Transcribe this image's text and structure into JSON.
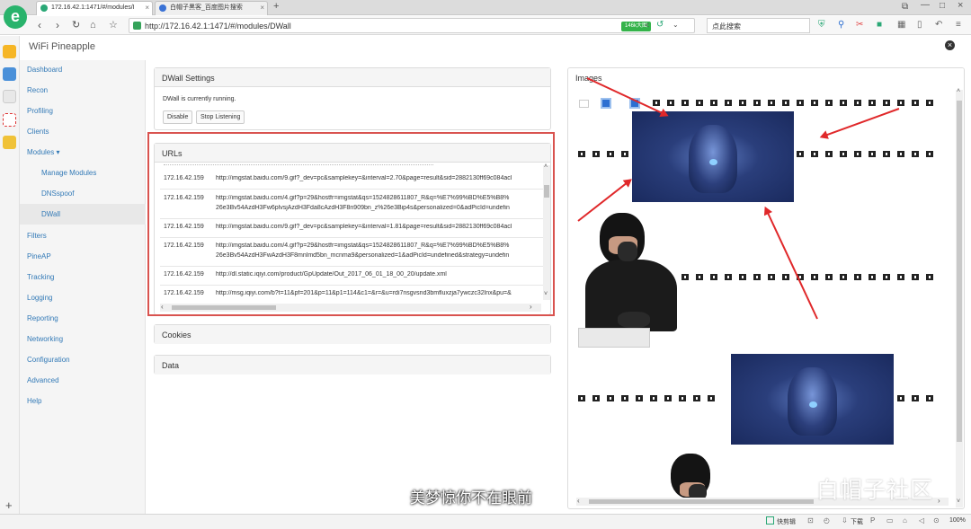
{
  "browser": {
    "tabs": [
      {
        "title": "172.16.42.1:1471/#/modules/I",
        "active": true
      },
      {
        "title": "白帽子黑客_百度图片搜索",
        "active": false
      }
    ],
    "new_tab": "+",
    "url": "http://172.16.42.1:1471/#/modules/DWall",
    "badge": "146k大图",
    "search_placeholder": "点此搜索"
  },
  "app": {
    "title": "WiFi Pineapple",
    "close": "×"
  },
  "sidebar": {
    "items": [
      {
        "label": "Dashboard"
      },
      {
        "label": "Recon"
      },
      {
        "label": "Profiling"
      },
      {
        "label": "Clients"
      },
      {
        "label": "Modules ▾"
      },
      {
        "label": "Filters"
      },
      {
        "label": "PineAP"
      },
      {
        "label": "Tracking"
      },
      {
        "label": "Logging"
      },
      {
        "label": "Reporting"
      },
      {
        "label": "Networking"
      },
      {
        "label": "Configuration"
      },
      {
        "label": "Advanced"
      },
      {
        "label": "Help"
      }
    ],
    "subitems": [
      {
        "label": "Manage Modules"
      },
      {
        "label": "DNSspoof"
      },
      {
        "label": "DWall"
      }
    ],
    "add": "+"
  },
  "dwall": {
    "title": "DWall Settings",
    "status": "DWall is currently running.",
    "disable_label": "Disable",
    "stop_label": "Stop Listening"
  },
  "urls": {
    "title": "URLs",
    "rows": [
      {
        "ip": "172.16.42.159",
        "url": "http://imgstat.baidu.com/9.gif?_dev=pc&samplekey=&interval=2.70&page=result&sid=2882130ff69c084acl",
        "url2": ""
      },
      {
        "ip": "172.16.42.159",
        "url": "http://imgstat.baidu.com/4.gif?p=29&hostfr=imgstat&qs=1524828611807_R&q=%E7%99%BD%E5%B8%",
        "url2": "26e3Bv54AzdH3Fw6plvsjAzdH3Fda8cAzdH3F8n909bn_z%26e3Bip4s&personalized=0&adPicId=undefin"
      },
      {
        "ip": "172.16.42.159",
        "url": "http://imgstat.baidu.com/9.gif?_dev=pc&samplekey=&interval=1.81&page=result&sid=2882130ff69c084acl",
        "url2": ""
      },
      {
        "ip": "172.16.42.159",
        "url": "http://imgstat.baidu.com/4.gif?p=29&hostfr=imgstat&qs=1524828611807_R&q=%E7%99%BD%E5%B8%",
        "url2": "26e3Bv54AzdH3FwAzdH3F8mnlmd5bn_mcnma9&personalized=1&adPicId=undefined&strategy=undefin"
      },
      {
        "ip": "172.16.42.159",
        "url": "http://dl.static.iqiyi.com/product/GpUpdate/Out_2017_06_01_18_00_20/update.xml",
        "url2": ""
      },
      {
        "ip": "172.16.42.159",
        "url": "http://msg.iqiyi.com/b?t=11&pf=201&p=11&p1=114&c1=&r=&u=rdi7nsgvsnd3bmfluxzja7ywczc32lnx&pu=&",
        "url2": ""
      }
    ]
  },
  "cookies": {
    "title": "Cookies"
  },
  "data_panel": {
    "title": "Data"
  },
  "images": {
    "title": "Images"
  },
  "overlay": {
    "subtitle": "美梦惊你不在眼前",
    "watermark": "白帽子社区"
  },
  "statusbar": {
    "quick_clip": "快剪辑",
    "download": "下载",
    "zoom": "100%"
  },
  "colors": {
    "accent_red": "#d9534f",
    "link": "#337ab7",
    "browser_green": "#34b34a"
  }
}
